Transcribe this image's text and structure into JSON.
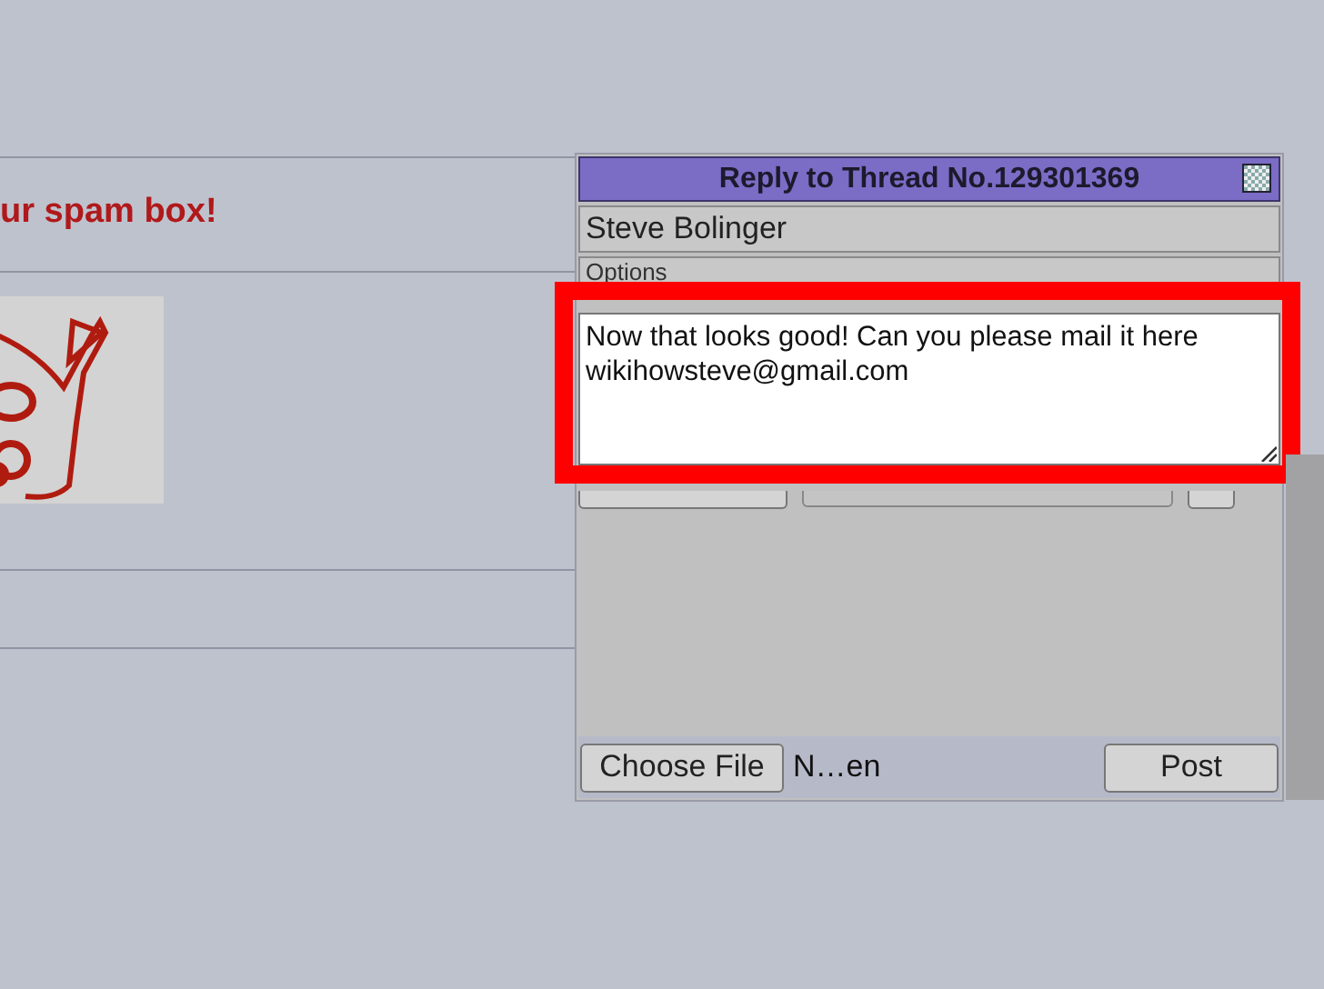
{
  "post": {
    "heading": "ur spam box!"
  },
  "reply_window": {
    "title": "Reply to Thread No.129301369",
    "name": "Steve Bolinger",
    "options_placeholder": "Options",
    "comment": "Now that looks good! Can you please mail it here\nwikihowsteve@gmail.com",
    "file_button": "Choose File",
    "file_status": "N…en",
    "post_button": "Post"
  }
}
